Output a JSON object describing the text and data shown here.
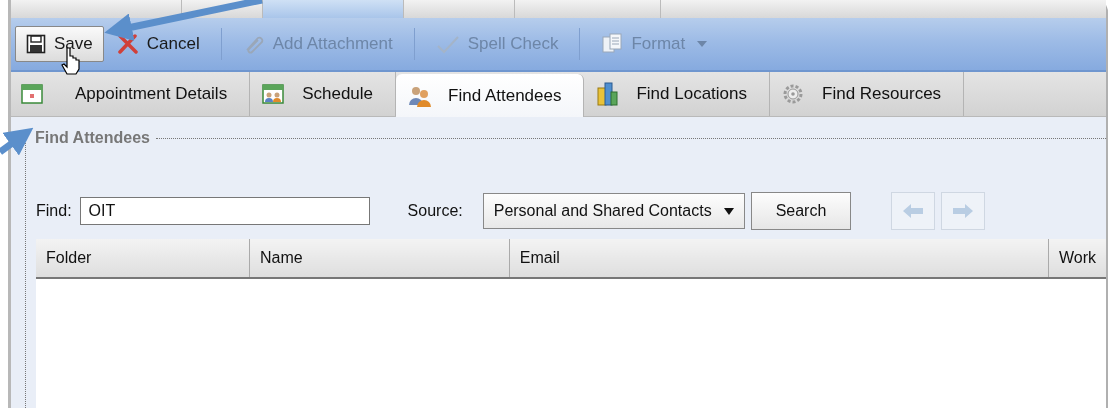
{
  "window_tabs": [
    {
      "selected": false
    },
    {
      "selected": false
    },
    {
      "selected": true
    },
    {
      "selected": false
    },
    {
      "selected": false
    }
  ],
  "toolbar": {
    "buttons": [
      {
        "label": "Save",
        "kind": "button",
        "disabled": false,
        "hovered": true
      },
      {
        "label": "Cancel",
        "kind": "button",
        "disabled": false,
        "hovered": false
      },
      {
        "label": "Add Attachment",
        "kind": "button",
        "disabled": true,
        "hovered": false
      },
      {
        "label": "Spell Check",
        "kind": "button",
        "disabled": true,
        "hovered": false
      },
      {
        "label": "Format",
        "kind": "dropdown",
        "disabled": true,
        "hovered": false
      }
    ]
  },
  "tabs": [
    {
      "label": "Appointment Details",
      "selected": false
    },
    {
      "label": "Schedule",
      "selected": false
    },
    {
      "label": "Find Attendees",
      "selected": true
    },
    {
      "label": "Find Locations",
      "selected": false
    },
    {
      "label": "Find Resources",
      "selected": false
    }
  ],
  "find_panel": {
    "legend": "Find Attendees",
    "find_label": "Find:",
    "find_value": "OIT",
    "source_label": "Source:",
    "source_value": "Personal and Shared Contacts",
    "search_button": "Search",
    "nav": [
      {
        "kind": "prev",
        "disabled": true
      },
      {
        "kind": "next",
        "disabled": true
      }
    ]
  },
  "table": {
    "columns": [
      "Folder",
      "Name",
      "Email",
      "Work"
    ]
  }
}
